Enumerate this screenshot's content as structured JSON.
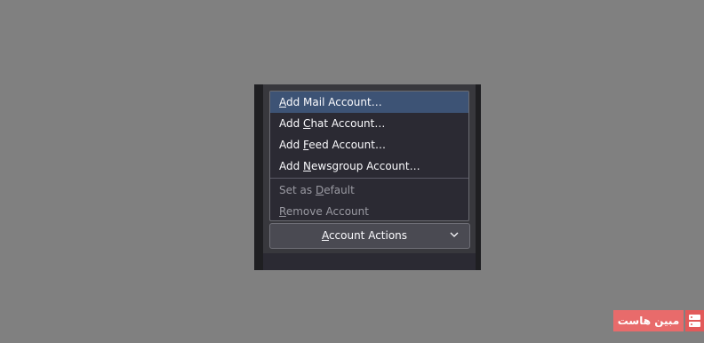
{
  "menu": {
    "items": [
      {
        "before": "",
        "key": "A",
        "after": "dd Mail Account…",
        "state": "active"
      },
      {
        "before": "Add ",
        "key": "C",
        "after": "hat Account…",
        "state": "normal"
      },
      {
        "before": "Add ",
        "key": "F",
        "after": "eed Account…",
        "state": "normal"
      },
      {
        "before": "Add ",
        "key": "N",
        "after": "ewsgroup Account…",
        "state": "normal"
      },
      {
        "before": "Set as ",
        "key": "D",
        "after": "efault",
        "state": "disabled"
      },
      {
        "before": "",
        "key": "R",
        "after": "emove Account",
        "state": "disabled"
      }
    ]
  },
  "account_actions": {
    "before": "",
    "key": "A",
    "after": "ccount Actions",
    "icon": "chevron-down-icon"
  },
  "watermark": {
    "text": "مبین هاست",
    "icon": "server-icon"
  },
  "colors": {
    "background": "#808080",
    "menu_bg": "#2b2a33",
    "highlight": "#3d5375",
    "text": "#fbfbfe",
    "disabled_text": "#9a9aa2",
    "watermark": "#e86b6b"
  }
}
